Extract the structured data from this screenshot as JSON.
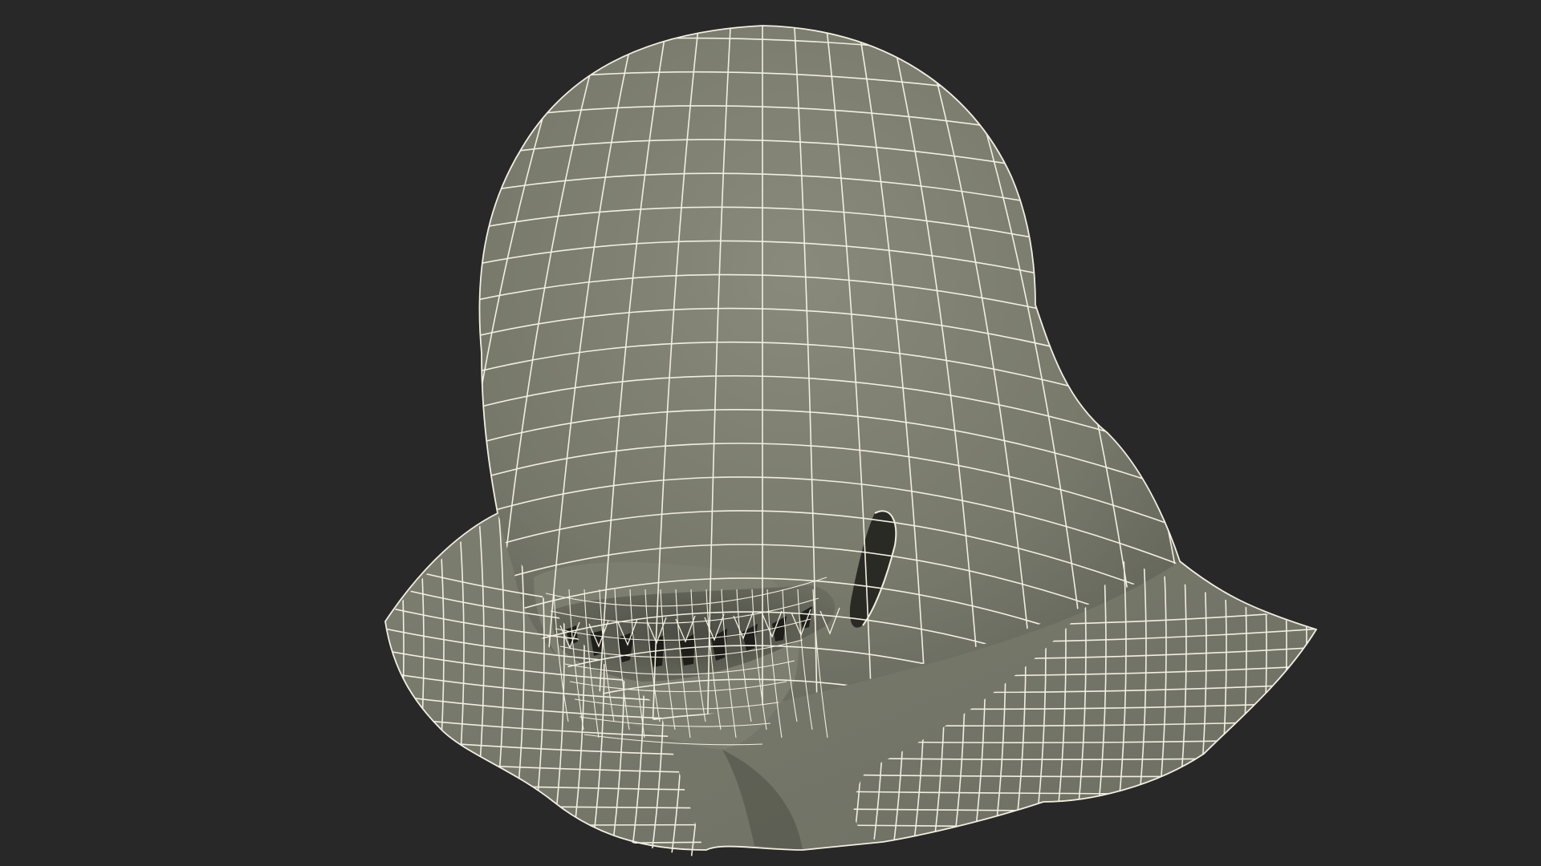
{
  "scene": {
    "subject": "alien-head-wireframe",
    "colors": {
      "background": "#282828",
      "surface_light": "#8a8a7c",
      "surface_mid": "#76786a",
      "surface_dark": "#5a5c52",
      "wire": "#f2efe0",
      "cavity": "#1e1e1a"
    }
  }
}
